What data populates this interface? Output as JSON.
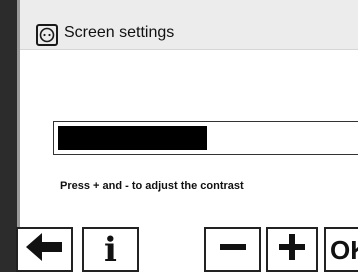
{
  "window": {
    "title": "Screen settings",
    "title_icon": "display-settings-icon"
  },
  "contrast": {
    "level_fraction": 0.48,
    "hint": "Press + and - to adjust the contrast"
  },
  "toolbar": {
    "back_icon": "arrow-left-icon",
    "info_icon": "info-icon",
    "info_glyph": "i",
    "minus_icon": "minus-icon",
    "plus_icon": "plus-icon",
    "ok_label": "OK"
  }
}
